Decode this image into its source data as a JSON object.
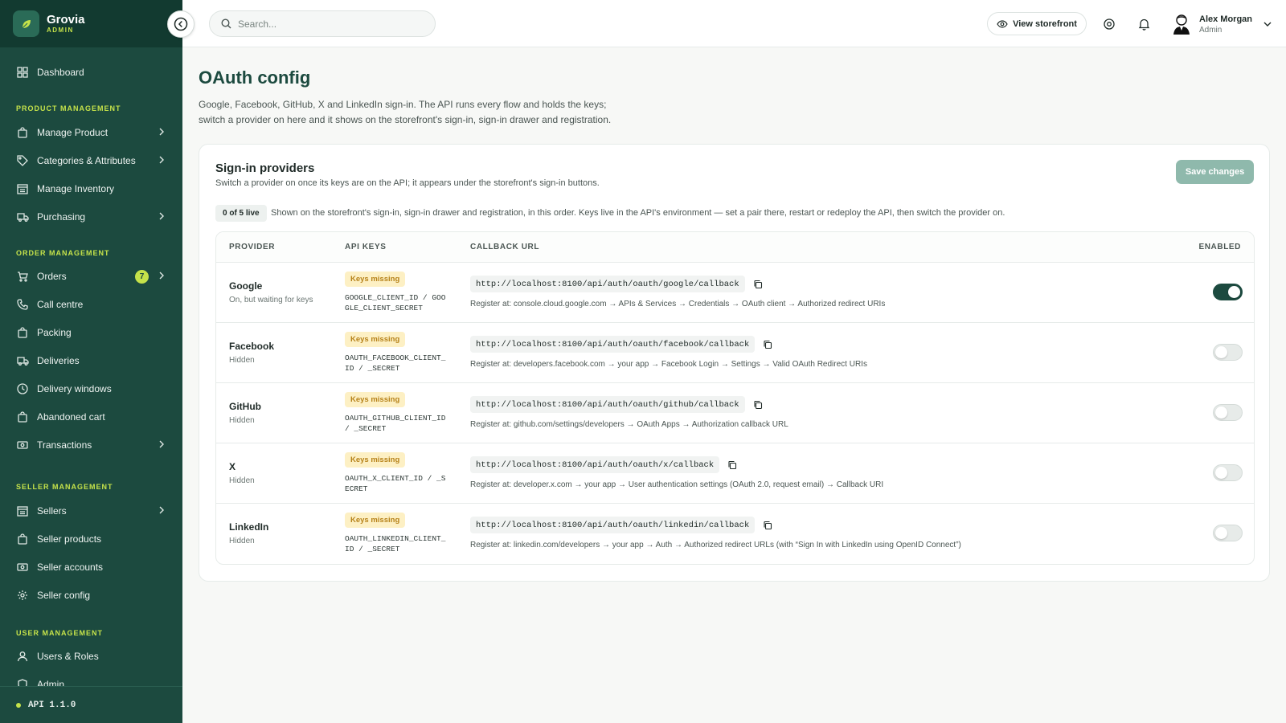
{
  "brand": {
    "name": "Grovia",
    "sub": "ADMIN"
  },
  "sidebar": {
    "dashboard": "Dashboard",
    "sections": {
      "product": "PRODUCT MANAGEMENT",
      "order": "ORDER MANAGEMENT",
      "seller": "SELLER MANAGEMENT",
      "user": "USER MANAGEMENT"
    },
    "items": {
      "manage_product": "Manage Product",
      "categories": "Categories & Attributes",
      "inventory": "Manage Inventory",
      "purchasing": "Purchasing",
      "orders": "Orders",
      "orders_badge": "7",
      "call_centre": "Call centre",
      "packing": "Packing",
      "deliveries": "Deliveries",
      "delivery_windows": "Delivery windows",
      "abandoned_cart": "Abandoned cart",
      "transactions": "Transactions",
      "sellers": "Sellers",
      "seller_products": "Seller products",
      "seller_accounts": "Seller accounts",
      "seller_config": "Seller config",
      "users_roles": "Users & Roles",
      "admin": "Admin"
    },
    "api_version": "API 1.1.0"
  },
  "topbar": {
    "search_placeholder": "Search...",
    "view_storefront": "View storefront",
    "user_name": "Alex Morgan",
    "user_role": "Admin"
  },
  "page": {
    "title": "OAuth config",
    "description": "Google, Facebook, GitHub, X and LinkedIn sign-in. The API runs every flow and holds the keys; switch a provider on here and it shows on the storefront's sign-in, sign-in drawer and registration."
  },
  "card": {
    "title": "Sign-in providers",
    "subtitle": "Switch a provider on once its keys are on the API; it appears under the storefront's sign-in buttons.",
    "save_label": "Save changes",
    "live_badge": "0 of 5 live",
    "info": "Shown on the storefront's sign-in, sign-in drawer and registration, in this order. Keys live in the API's environment — set a pair there, restart or redeploy the API, then switch the provider on."
  },
  "table": {
    "headers": {
      "provider": "PROVIDER",
      "api_keys": "API KEYS",
      "callback_url": "CALLBACK URL",
      "enabled": "ENABLED"
    },
    "rows": [
      {
        "name": "Google",
        "status": "On, but waiting for keys",
        "keys_badge": "Keys missing",
        "env": "GOOGLE_CLIENT_ID / GOOGLE_CLIENT_SECRET",
        "callback": "http://localhost:8100/api/auth/oauth/google/callback",
        "register": "Register at: console.cloud.google.com → APIs & Services → Credentials → OAuth client → Authorized redirect URIs",
        "enabled": true
      },
      {
        "name": "Facebook",
        "status": "Hidden",
        "keys_badge": "Keys missing",
        "env": "OAUTH_FACEBOOK_CLIENT_ID / _SECRET",
        "callback": "http://localhost:8100/api/auth/oauth/facebook/callback",
        "register": "Register at: developers.facebook.com → your app → Facebook Login → Settings → Valid OAuth Redirect URIs",
        "enabled": false
      },
      {
        "name": "GitHub",
        "status": "Hidden",
        "keys_badge": "Keys missing",
        "env": "OAUTH_GITHUB_CLIENT_ID / _SECRET",
        "callback": "http://localhost:8100/api/auth/oauth/github/callback",
        "register": "Register at: github.com/settings/developers → OAuth Apps → Authorization callback URL",
        "enabled": false
      },
      {
        "name": "X",
        "status": "Hidden",
        "keys_badge": "Keys missing",
        "env": "OAUTH_X_CLIENT_ID / _SECRET",
        "callback": "http://localhost:8100/api/auth/oauth/x/callback",
        "register": "Register at: developer.x.com → your app → User authentication settings (OAuth 2.0, request email) → Callback URI",
        "enabled": false
      },
      {
        "name": "LinkedIn",
        "status": "Hidden",
        "keys_badge": "Keys missing",
        "env": "OAUTH_LINKEDIN_CLIENT_ID / _SECRET",
        "callback": "http://localhost:8100/api/auth/oauth/linkedin/callback",
        "register": "Register at: linkedin.com/developers → your app → Auth → Authorized redirect URLs (with “Sign In with LinkedIn using OpenID Connect”)",
        "enabled": false
      }
    ]
  },
  "colors": {
    "brand_green": "#1c4a3f",
    "accent_lime": "#c5e24a",
    "warning_bg": "#fdf0c4",
    "warning_text": "#b7831a"
  }
}
